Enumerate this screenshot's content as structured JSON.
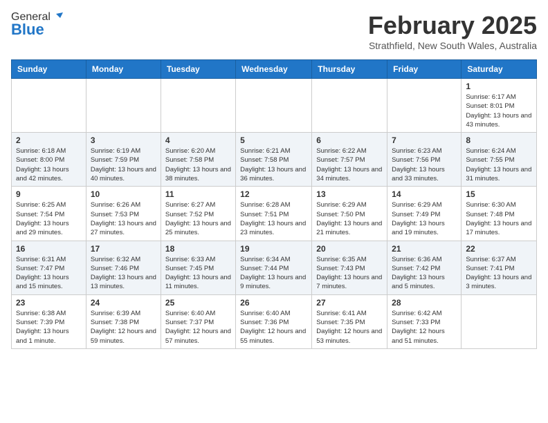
{
  "header": {
    "logo_general": "General",
    "logo_blue": "Blue",
    "title": "February 2025",
    "subtitle": "Strathfield, New South Wales, Australia"
  },
  "days_of_week": [
    "Sunday",
    "Monday",
    "Tuesday",
    "Wednesday",
    "Thursday",
    "Friday",
    "Saturday"
  ],
  "weeks": [
    [
      {
        "day": "",
        "info": ""
      },
      {
        "day": "",
        "info": ""
      },
      {
        "day": "",
        "info": ""
      },
      {
        "day": "",
        "info": ""
      },
      {
        "day": "",
        "info": ""
      },
      {
        "day": "",
        "info": ""
      },
      {
        "day": "1",
        "info": "Sunrise: 6:17 AM\nSunset: 8:01 PM\nDaylight: 13 hours and 43 minutes."
      }
    ],
    [
      {
        "day": "2",
        "info": "Sunrise: 6:18 AM\nSunset: 8:00 PM\nDaylight: 13 hours and 42 minutes."
      },
      {
        "day": "3",
        "info": "Sunrise: 6:19 AM\nSunset: 7:59 PM\nDaylight: 13 hours and 40 minutes."
      },
      {
        "day": "4",
        "info": "Sunrise: 6:20 AM\nSunset: 7:58 PM\nDaylight: 13 hours and 38 minutes."
      },
      {
        "day": "5",
        "info": "Sunrise: 6:21 AM\nSunset: 7:58 PM\nDaylight: 13 hours and 36 minutes."
      },
      {
        "day": "6",
        "info": "Sunrise: 6:22 AM\nSunset: 7:57 PM\nDaylight: 13 hours and 34 minutes."
      },
      {
        "day": "7",
        "info": "Sunrise: 6:23 AM\nSunset: 7:56 PM\nDaylight: 13 hours and 33 minutes."
      },
      {
        "day": "8",
        "info": "Sunrise: 6:24 AM\nSunset: 7:55 PM\nDaylight: 13 hours and 31 minutes."
      }
    ],
    [
      {
        "day": "9",
        "info": "Sunrise: 6:25 AM\nSunset: 7:54 PM\nDaylight: 13 hours and 29 minutes."
      },
      {
        "day": "10",
        "info": "Sunrise: 6:26 AM\nSunset: 7:53 PM\nDaylight: 13 hours and 27 minutes."
      },
      {
        "day": "11",
        "info": "Sunrise: 6:27 AM\nSunset: 7:52 PM\nDaylight: 13 hours and 25 minutes."
      },
      {
        "day": "12",
        "info": "Sunrise: 6:28 AM\nSunset: 7:51 PM\nDaylight: 13 hours and 23 minutes."
      },
      {
        "day": "13",
        "info": "Sunrise: 6:29 AM\nSunset: 7:50 PM\nDaylight: 13 hours and 21 minutes."
      },
      {
        "day": "14",
        "info": "Sunrise: 6:29 AM\nSunset: 7:49 PM\nDaylight: 13 hours and 19 minutes."
      },
      {
        "day": "15",
        "info": "Sunrise: 6:30 AM\nSunset: 7:48 PM\nDaylight: 13 hours and 17 minutes."
      }
    ],
    [
      {
        "day": "16",
        "info": "Sunrise: 6:31 AM\nSunset: 7:47 PM\nDaylight: 13 hours and 15 minutes."
      },
      {
        "day": "17",
        "info": "Sunrise: 6:32 AM\nSunset: 7:46 PM\nDaylight: 13 hours and 13 minutes."
      },
      {
        "day": "18",
        "info": "Sunrise: 6:33 AM\nSunset: 7:45 PM\nDaylight: 13 hours and 11 minutes."
      },
      {
        "day": "19",
        "info": "Sunrise: 6:34 AM\nSunset: 7:44 PM\nDaylight: 13 hours and 9 minutes."
      },
      {
        "day": "20",
        "info": "Sunrise: 6:35 AM\nSunset: 7:43 PM\nDaylight: 13 hours and 7 minutes."
      },
      {
        "day": "21",
        "info": "Sunrise: 6:36 AM\nSunset: 7:42 PM\nDaylight: 13 hours and 5 minutes."
      },
      {
        "day": "22",
        "info": "Sunrise: 6:37 AM\nSunset: 7:41 PM\nDaylight: 13 hours and 3 minutes."
      }
    ],
    [
      {
        "day": "23",
        "info": "Sunrise: 6:38 AM\nSunset: 7:39 PM\nDaylight: 13 hours and 1 minute."
      },
      {
        "day": "24",
        "info": "Sunrise: 6:39 AM\nSunset: 7:38 PM\nDaylight: 12 hours and 59 minutes."
      },
      {
        "day": "25",
        "info": "Sunrise: 6:40 AM\nSunset: 7:37 PM\nDaylight: 12 hours and 57 minutes."
      },
      {
        "day": "26",
        "info": "Sunrise: 6:40 AM\nSunset: 7:36 PM\nDaylight: 12 hours and 55 minutes."
      },
      {
        "day": "27",
        "info": "Sunrise: 6:41 AM\nSunset: 7:35 PM\nDaylight: 12 hours and 53 minutes."
      },
      {
        "day": "28",
        "info": "Sunrise: 6:42 AM\nSunset: 7:33 PM\nDaylight: 12 hours and 51 minutes."
      },
      {
        "day": "",
        "info": ""
      }
    ]
  ]
}
